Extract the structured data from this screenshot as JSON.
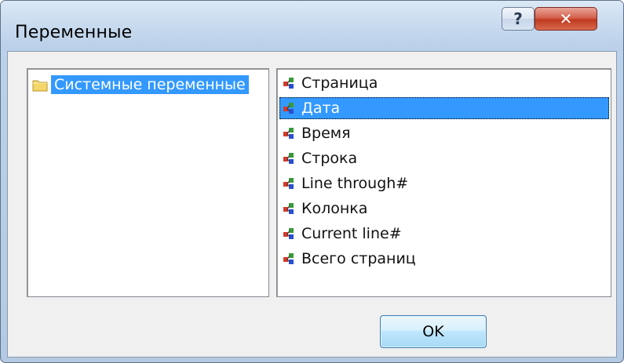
{
  "window": {
    "title": "Переменные",
    "help_label": "?",
    "close_label": "✕"
  },
  "tree": {
    "items": [
      {
        "label": "Системные переменные",
        "icon": "folder-icon",
        "selected": true
      }
    ]
  },
  "variables": {
    "items": [
      {
        "label": "Страница",
        "icon": "variable-icon",
        "selected": false
      },
      {
        "label": "Дата",
        "icon": "variable-icon",
        "selected": true
      },
      {
        "label": "Время",
        "icon": "variable-icon",
        "selected": false
      },
      {
        "label": "Строка",
        "icon": "variable-icon",
        "selected": false
      },
      {
        "label": "Line through#",
        "icon": "variable-icon",
        "selected": false
      },
      {
        "label": "Колонка",
        "icon": "variable-icon",
        "selected": false
      },
      {
        "label": "Current line#",
        "icon": "variable-icon",
        "selected": false
      },
      {
        "label": "Всего страниц",
        "icon": "variable-icon",
        "selected": false
      }
    ]
  },
  "buttons": {
    "ok_label": "OK"
  },
  "colors": {
    "selection": "#3399ff",
    "close_red": "#c0391f"
  }
}
